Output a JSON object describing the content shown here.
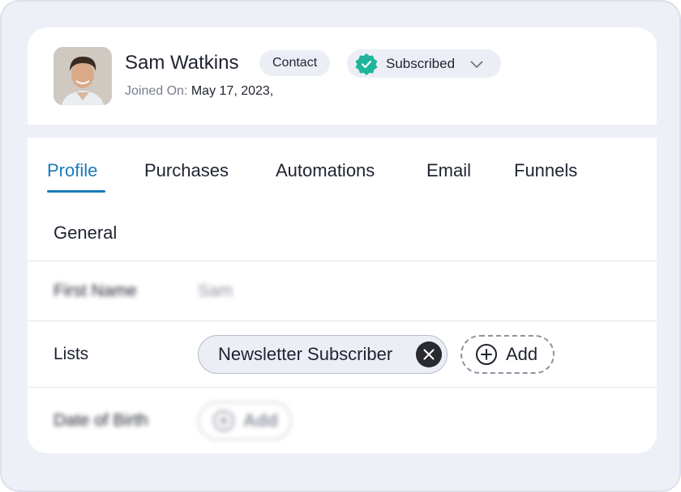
{
  "contact": {
    "name": "Sam Watkins",
    "role_badge": "Contact",
    "status": "Subscribed",
    "joined_label": "Joined On:",
    "joined_date": "May 17, 2023,"
  },
  "tabs": [
    {
      "label": "Profile",
      "active": true
    },
    {
      "label": "Purchases"
    },
    {
      "label": "Automations"
    },
    {
      "label": "Email"
    },
    {
      "label": "Funnels"
    }
  ],
  "general": {
    "title": "General",
    "first_name_label": "First Name",
    "first_name_value": "Sam",
    "lists_label": "Lists",
    "list_chip": "Newsletter Subscriber",
    "add_label": "Add",
    "dob_label": "Date of Birth",
    "dob_add_label": "Add"
  },
  "colors": {
    "accent": "#1a7bb8",
    "status_check": "#1fb59a",
    "badge_bg": "#eceef6",
    "frame_bg": "#eef0f8"
  },
  "icons": {
    "status": "verified-check-icon",
    "status_dropdown": "chevron-down-icon",
    "remove": "close-icon",
    "add": "plus-circle-icon"
  }
}
